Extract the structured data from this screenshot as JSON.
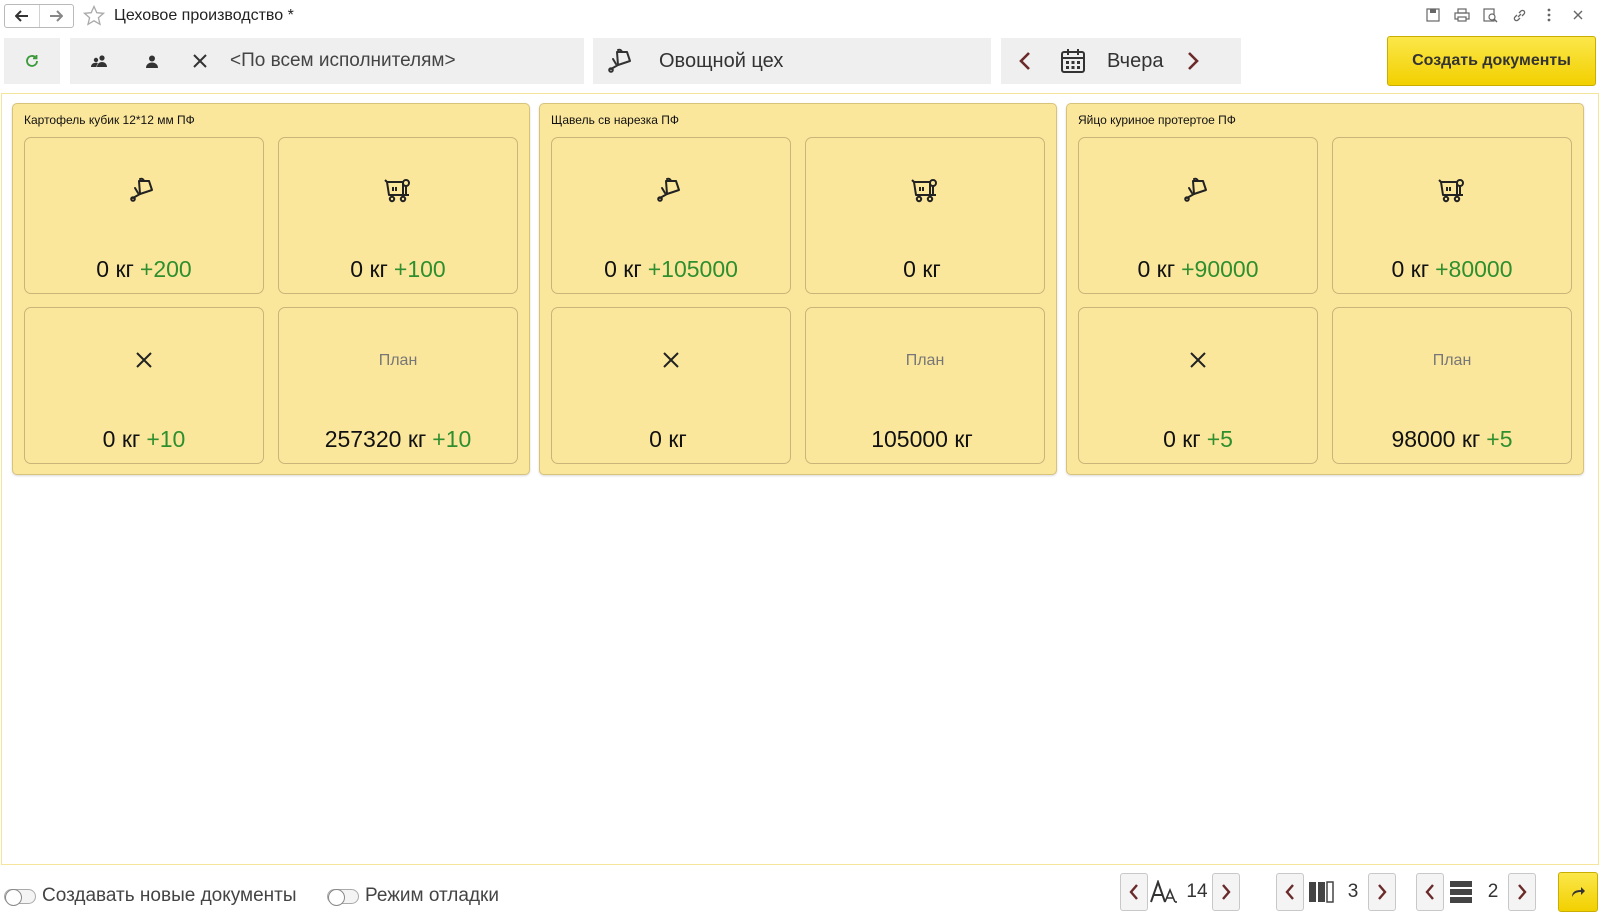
{
  "window": {
    "title": "Цеховое производство *"
  },
  "toolbar": {
    "performer_text": "<По всем исполнителям>",
    "workshop_text": "Овощной цех",
    "date_text": "Вчера",
    "create_label": "Создать документы"
  },
  "cards": [
    {
      "title": "Картофель кубик 12*12 мм ПФ",
      "tiles": [
        {
          "value": "0 кг",
          "delta": "+200"
        },
        {
          "value": "0 кг",
          "delta": "+100"
        },
        {
          "value": "0 кг",
          "delta": "+10"
        },
        {
          "plan": "План",
          "value": "257320 кг",
          "delta": "+10"
        }
      ]
    },
    {
      "title": "Щавель св нарезка ПФ",
      "tiles": [
        {
          "value": "0 кг",
          "delta": "+105000"
        },
        {
          "value": "0 кг",
          "delta": ""
        },
        {
          "value": "0 кг",
          "delta": ""
        },
        {
          "plan": "План",
          "value": "105000 кг",
          "delta": ""
        }
      ]
    },
    {
      "title": "Яйцо куриное протертое ПФ",
      "tiles": [
        {
          "value": "0 кг",
          "delta": "+90000"
        },
        {
          "value": "0 кг",
          "delta": "+80000"
        },
        {
          "value": "0 кг",
          "delta": "+5"
        },
        {
          "plan": "План",
          "value": "98000 кг",
          "delta": "+5"
        }
      ]
    }
  ],
  "status": {
    "toggle_create_new": "Создавать новые документы",
    "toggle_debug": "Режим отладки",
    "font_size": "14",
    "columns": "3",
    "rows": "2"
  },
  "icons": {
    "tile_1": "scale-icon",
    "tile_2": "cart-icon",
    "tile_3": "cross-icon"
  },
  "colors": {
    "card_bg": "#fbe79c",
    "accent_button": "#f2d000",
    "delta_green": "#2f8f2f",
    "refresh_green": "#3a9a3a",
    "arrow_dark_red": "#6b2a2a"
  }
}
